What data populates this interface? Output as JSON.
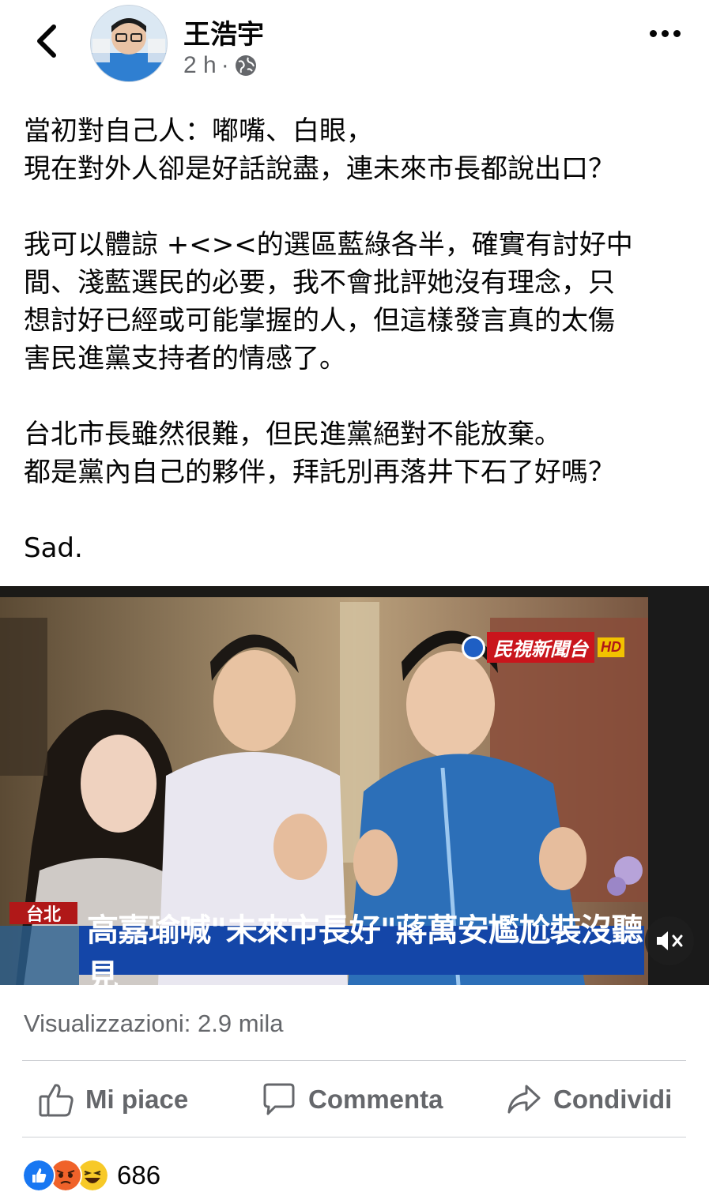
{
  "header": {
    "author_name": "王浩宇",
    "time": "2 h",
    "separator": "·",
    "icons": {
      "back": "chevron-left-icon",
      "privacy": "globe-icon",
      "more": "more-horizontal-icon"
    }
  },
  "post": {
    "paragraphs": [
      [
        "當初對自己人：嘟嘴、白眼，",
        "現在對外人卻是好話說盡，連未來市長都說出口？"
      ],
      [
        "我可以體諒 +<><的選區藍綠各半，確實有討好中",
        "間、淺藍選民的必要，我不會批評她沒有理念，只",
        "想討好已經或可能掌握的人，但這樣發言真的太傷",
        "害民進黨支持者的情感了。"
      ],
      [
        "台北市長雖然很難，但民進黨絕對不能放棄。",
        "都是黨內自己的夥伴，拜託別再落井下石了好嗎？"
      ],
      [
        "Sad."
      ]
    ]
  },
  "video": {
    "location_tag": "台北",
    "headline": "高嘉瑜喊\"未來市長好\"蔣萬安尷尬裝沒聽見",
    "station_name": "民視新聞台",
    "station_badge": "HD",
    "mute_icon": "speaker-muted-icon",
    "colors": {
      "headline_bg": "#1446a8",
      "tag_bg": "#b01818",
      "station_bg": "#c9151c"
    }
  },
  "stats": {
    "views": "Visualizzazioni: 2.9 mila"
  },
  "actions": {
    "like_label": "Mi piace",
    "comment_label": "Commenta",
    "share_label": "Condividi"
  },
  "reactions": {
    "types": [
      "like-reaction-icon",
      "angry-reaction-icon",
      "haha-reaction-icon"
    ],
    "count": "686"
  }
}
